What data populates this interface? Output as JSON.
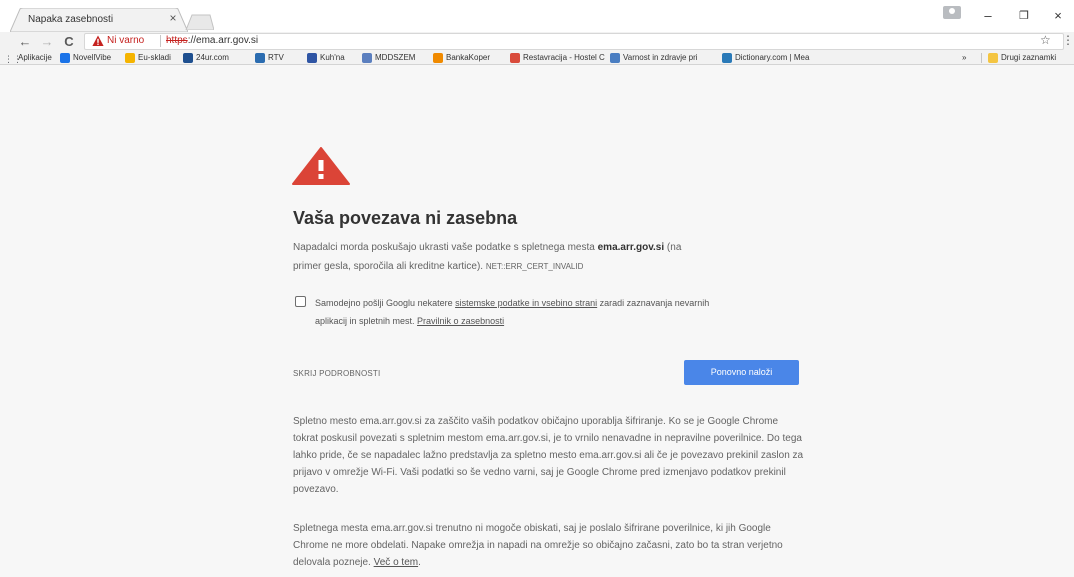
{
  "browser": {
    "tab_title": "Napaka zasebnosti",
    "tab_close": "×",
    "window_minimize": "–",
    "window_restore": "❐",
    "window_close": "×"
  },
  "toolbar": {
    "back": "←",
    "forward": "→",
    "reload": "C",
    "security_label": "Ni varno",
    "url_scheme": "https",
    "url_rest": "://ema.arr.gov.si",
    "star": "☆",
    "menu": "⋮"
  },
  "bookmarks": {
    "items": [
      {
        "label": "Aplikacije",
        "icon": "apps-icon",
        "color": "#5f6368"
      },
      {
        "label": "NovellVibe",
        "icon": "novellvibe-icon",
        "color": "#1a73e8"
      },
      {
        "label": "Eu-skladi",
        "icon": "eu-skladi-icon",
        "color": "#f5b400"
      },
      {
        "label": "24ur.com",
        "icon": "24ur-icon",
        "color": "#1e4f8f"
      },
      {
        "label": "RTV",
        "icon": "rtv-icon",
        "color": "#2b6cb0"
      },
      {
        "label": "Kuh'na",
        "icon": "kuhna-icon",
        "color": "#2f55a4"
      },
      {
        "label": "MDDSZEM",
        "icon": "mddszem-icon",
        "color": "#5b7fbf"
      },
      {
        "label": "BankaKoper",
        "icon": "bankakoper-icon",
        "color": "#f08a00"
      },
      {
        "label": "Restavracija - Hostel C",
        "icon": "restavracija-icon",
        "color": "#d94b3b"
      },
      {
        "label": "Varnost in zdravje pri",
        "icon": "varnost-icon",
        "color": "#4a7ec2"
      },
      {
        "label": "Dictionary.com | Mea",
        "icon": "dictionary-icon",
        "color": "#2a7ab8"
      }
    ],
    "overflow": "»",
    "other_label": "Drugi zaznamki",
    "other_color": "#f4c542"
  },
  "interstitial": {
    "heading": "Vaša povezava ni zasebna",
    "intro_before": "Napadalci morda poskušajo ukrasti vaše podatke s spletnega mesta ",
    "intro_site": "ema.arr.gov.si",
    "intro_after": " (na",
    "intro_line2": "primer gesla, sporočila ali kreditne kartice). ",
    "error_code": "NET::ERR_CERT_INVALID",
    "checkbox_before": "Samodejno pošlji Googlu nekatere ",
    "checkbox_link1": "sistemske podatke in vsebino strani",
    "checkbox_middle": " zaradi zaznavanja nevarnih",
    "checkbox_line2": "aplikacij in spletnih mest. ",
    "checkbox_link2": "Pravilnik o zasebnosti",
    "details_button": "SKRIJ PODROBNOSTI",
    "reload_button": "Ponovno naloži",
    "details_p1": "Spletno mesto ema.arr.gov.si za zaščito vaših podatkov običajno uporablja šifriranje. Ko se je Google Chrome tokrat poskusil povezati s spletnim mestom ema.arr.gov.si, je to vrnilo nenavadne in nepravilne poverilnice. Do tega lahko pride, če se napadalec lažno predstavlja za spletno mesto ema.arr.gov.si ali če je povezavo prekinil zaslon za prijavo v omrežje Wi-Fi. Vaši podatki so še vedno varni, saj je Google Chrome pred izmenjavo podatkov prekinil povezavo.",
    "details_p2": "Spletnega mesta ema.arr.gov.si trenutno ni mogoče obiskati, saj je poslalo šifrirane poverilnice, ki jih Google Chrome ne more obdelati. Napake omrežja in napadi na omrežje so običajno začasni, zato bo ta stran verjetno delovala pozneje. ",
    "learn_more": "Več o tem",
    "period": ".",
    "accent_color": "#db4437",
    "button_color": "#4a86e8"
  }
}
